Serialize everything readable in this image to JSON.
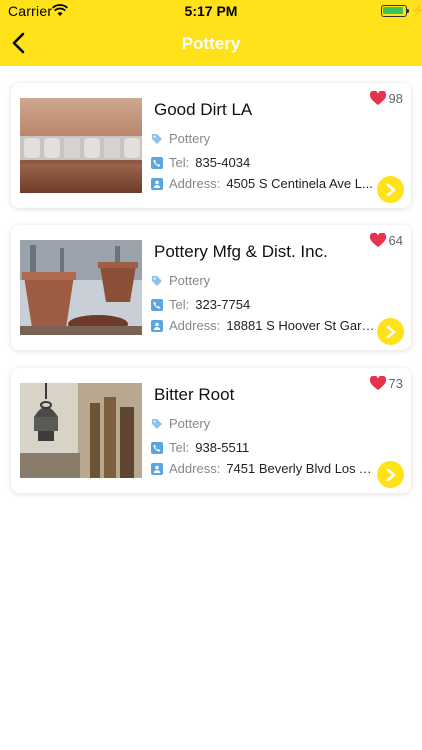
{
  "status_bar": {
    "carrier": "Carrier",
    "time": "5:17 PM"
  },
  "nav": {
    "title": "Pottery",
    "back_icon": "chevron-left-icon"
  },
  "colors": {
    "accent": "#ffe21a",
    "heart": "#e8334f"
  },
  "listings": [
    {
      "name": "Good Dirt LA",
      "likes": "98",
      "category": "Pottery",
      "tel_label": "Tel:",
      "tel": "835-4034",
      "address_label": "Address:",
      "address": "4505 S Centinela Ave L..."
    },
    {
      "name": "Pottery Mfg & Dist. Inc.",
      "likes": "64",
      "category": "Pottery",
      "tel_label": "Tel:",
      "tel": "323-7754",
      "address_label": "Address:",
      "address": "18881 S Hoover St Gard..."
    },
    {
      "name": "Bitter Root",
      "likes": "73",
      "category": "Pottery",
      "tel_label": "Tel:",
      "tel": "938-5511",
      "address_label": "Address:",
      "address": "7451 Beverly Blvd Los A..."
    }
  ]
}
